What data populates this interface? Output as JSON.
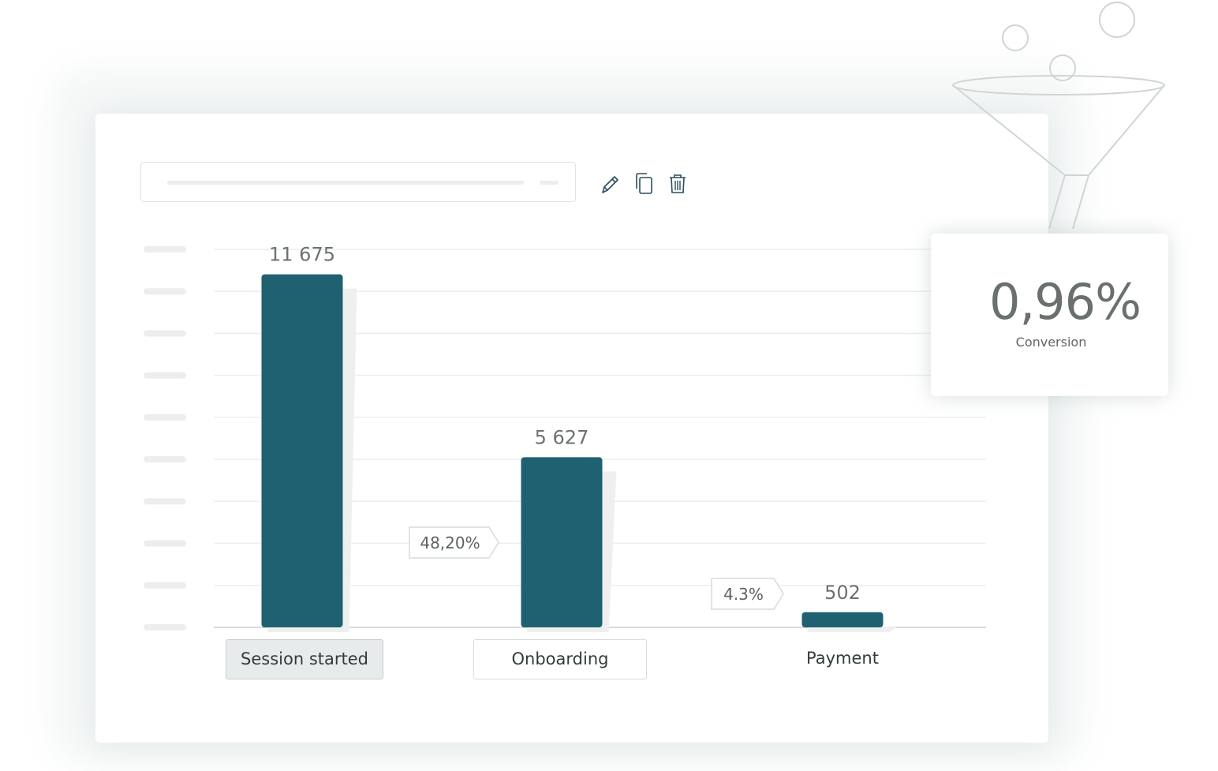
{
  "toolbar": {
    "edit_icon": "pencil-icon",
    "copy_icon": "copy-icon",
    "delete_icon": "trash-icon"
  },
  "chart_data": {
    "type": "bar",
    "categories": [
      "Session started",
      "Onboarding",
      "Payment"
    ],
    "values": [
      11675,
      5627,
      502
    ],
    "value_labels": [
      "11 675",
      "5 627",
      "502"
    ],
    "step_conversions": [
      "48,20%",
      "4.3%"
    ],
    "ylim": [
      0,
      12500
    ],
    "gridlines": 10,
    "grid": true,
    "bar_color": "#1f6170",
    "active_category": "Session started"
  },
  "conversion": {
    "value": "0,96%",
    "label": "Conversion"
  }
}
